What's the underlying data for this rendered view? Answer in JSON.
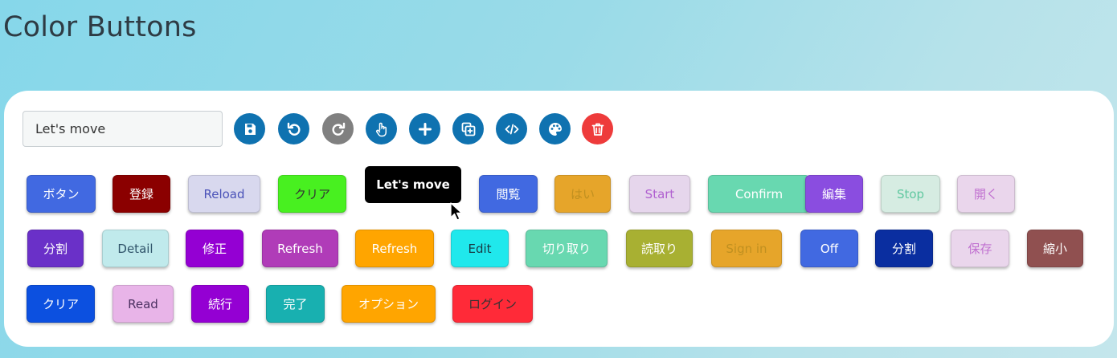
{
  "page": {
    "title": "Color Buttons"
  },
  "input": {
    "value": "Let's move"
  },
  "toolbar": {
    "icons": [
      {
        "name": "save-icon",
        "color": "#0f72b0"
      },
      {
        "name": "undo-icon",
        "color": "#0f72b0"
      },
      {
        "name": "redo-icon",
        "color": "#808080"
      },
      {
        "name": "hand-pointer-icon",
        "color": "#0f72b0"
      },
      {
        "name": "add-icon",
        "color": "#0f72b0"
      },
      {
        "name": "copy-add-icon",
        "color": "#0f72b0"
      },
      {
        "name": "code-icon",
        "color": "#0f72b0"
      },
      {
        "name": "palette-icon",
        "color": "#0f72b0"
      },
      {
        "name": "trash-icon",
        "color": "#ee3b3b"
      }
    ]
  },
  "tooltip": {
    "text": "Let's move"
  },
  "buttons": [
    {
      "label": "ボタン",
      "bg": "#4169e1",
      "color": "#ffffff"
    },
    {
      "label": "登録",
      "bg": "#8b0000",
      "color": "#ffffff"
    },
    {
      "label": "Reload",
      "bg": "#d8d8ee",
      "color": "#4a52b8"
    },
    {
      "label": "クリア",
      "bg": "#48f020",
      "color": "#333333"
    },
    {
      "label": "閲覧",
      "bg": "#4169e1",
      "color": "#ffffff"
    },
    {
      "label": "はい",
      "bg": "#e6a52a",
      "color": "#c09020"
    },
    {
      "label": "Start",
      "bg": "#e6d6ec",
      "color": "#b060d0"
    },
    {
      "label": "Confirm",
      "bg": "#68d8b0",
      "color": "#ffffff"
    },
    {
      "label": "編集",
      "bg": "#8a4de0",
      "color": "#ffffff"
    },
    {
      "label": "Stop",
      "bg": "#d6ece2",
      "color": "#60c8a0"
    },
    {
      "label": "開く",
      "bg": "#ead6ec",
      "color": "#c070d0"
    },
    {
      "label": "分割",
      "bg": "#6a30c8",
      "color": "#ffffff"
    },
    {
      "label": "Detail",
      "bg": "#c0eaec",
      "color": "#30546a"
    },
    {
      "label": "修正",
      "bg": "#9400d3",
      "color": "#ffffff"
    },
    {
      "label": "Refresh",
      "bg": "#b03cb8",
      "color": "#ffffff"
    },
    {
      "label": "Refresh",
      "bg": "#ffa500",
      "color": "#ffffff"
    },
    {
      "label": "Edit",
      "bg": "#20e8ec",
      "color": "#1a3a44"
    },
    {
      "label": "切り取り",
      "bg": "#68d8b0",
      "color": "#ffffff"
    },
    {
      "label": "読取り",
      "bg": "#a8b032",
      "color": "#ffffff"
    },
    {
      "label": "Sign in",
      "bg": "#e6a52a",
      "color": "#c09020"
    },
    {
      "label": "Off",
      "bg": "#4169e1",
      "color": "#ffffff"
    },
    {
      "label": "分割",
      "bg": "#0a2ea0",
      "color": "#ffffff"
    },
    {
      "label": "保存",
      "bg": "#ead6ec",
      "color": "#c070d0"
    },
    {
      "label": "縮小",
      "bg": "#905050",
      "color": "#ffffff"
    },
    {
      "label": "クリア",
      "bg": "#0c50e0",
      "color": "#ffffff"
    },
    {
      "label": "Read",
      "bg": "#e8b4e8",
      "color": "#4a3060"
    },
    {
      "label": "続行",
      "bg": "#9400d3",
      "color": "#ffffff"
    },
    {
      "label": "完了",
      "bg": "#18b0b0",
      "color": "#ffffff"
    },
    {
      "label": "オプション",
      "bg": "#ffa500",
      "color": "#ffffff"
    },
    {
      "label": "ログイン",
      "bg": "#ff2a38",
      "color": "#333333"
    }
  ]
}
